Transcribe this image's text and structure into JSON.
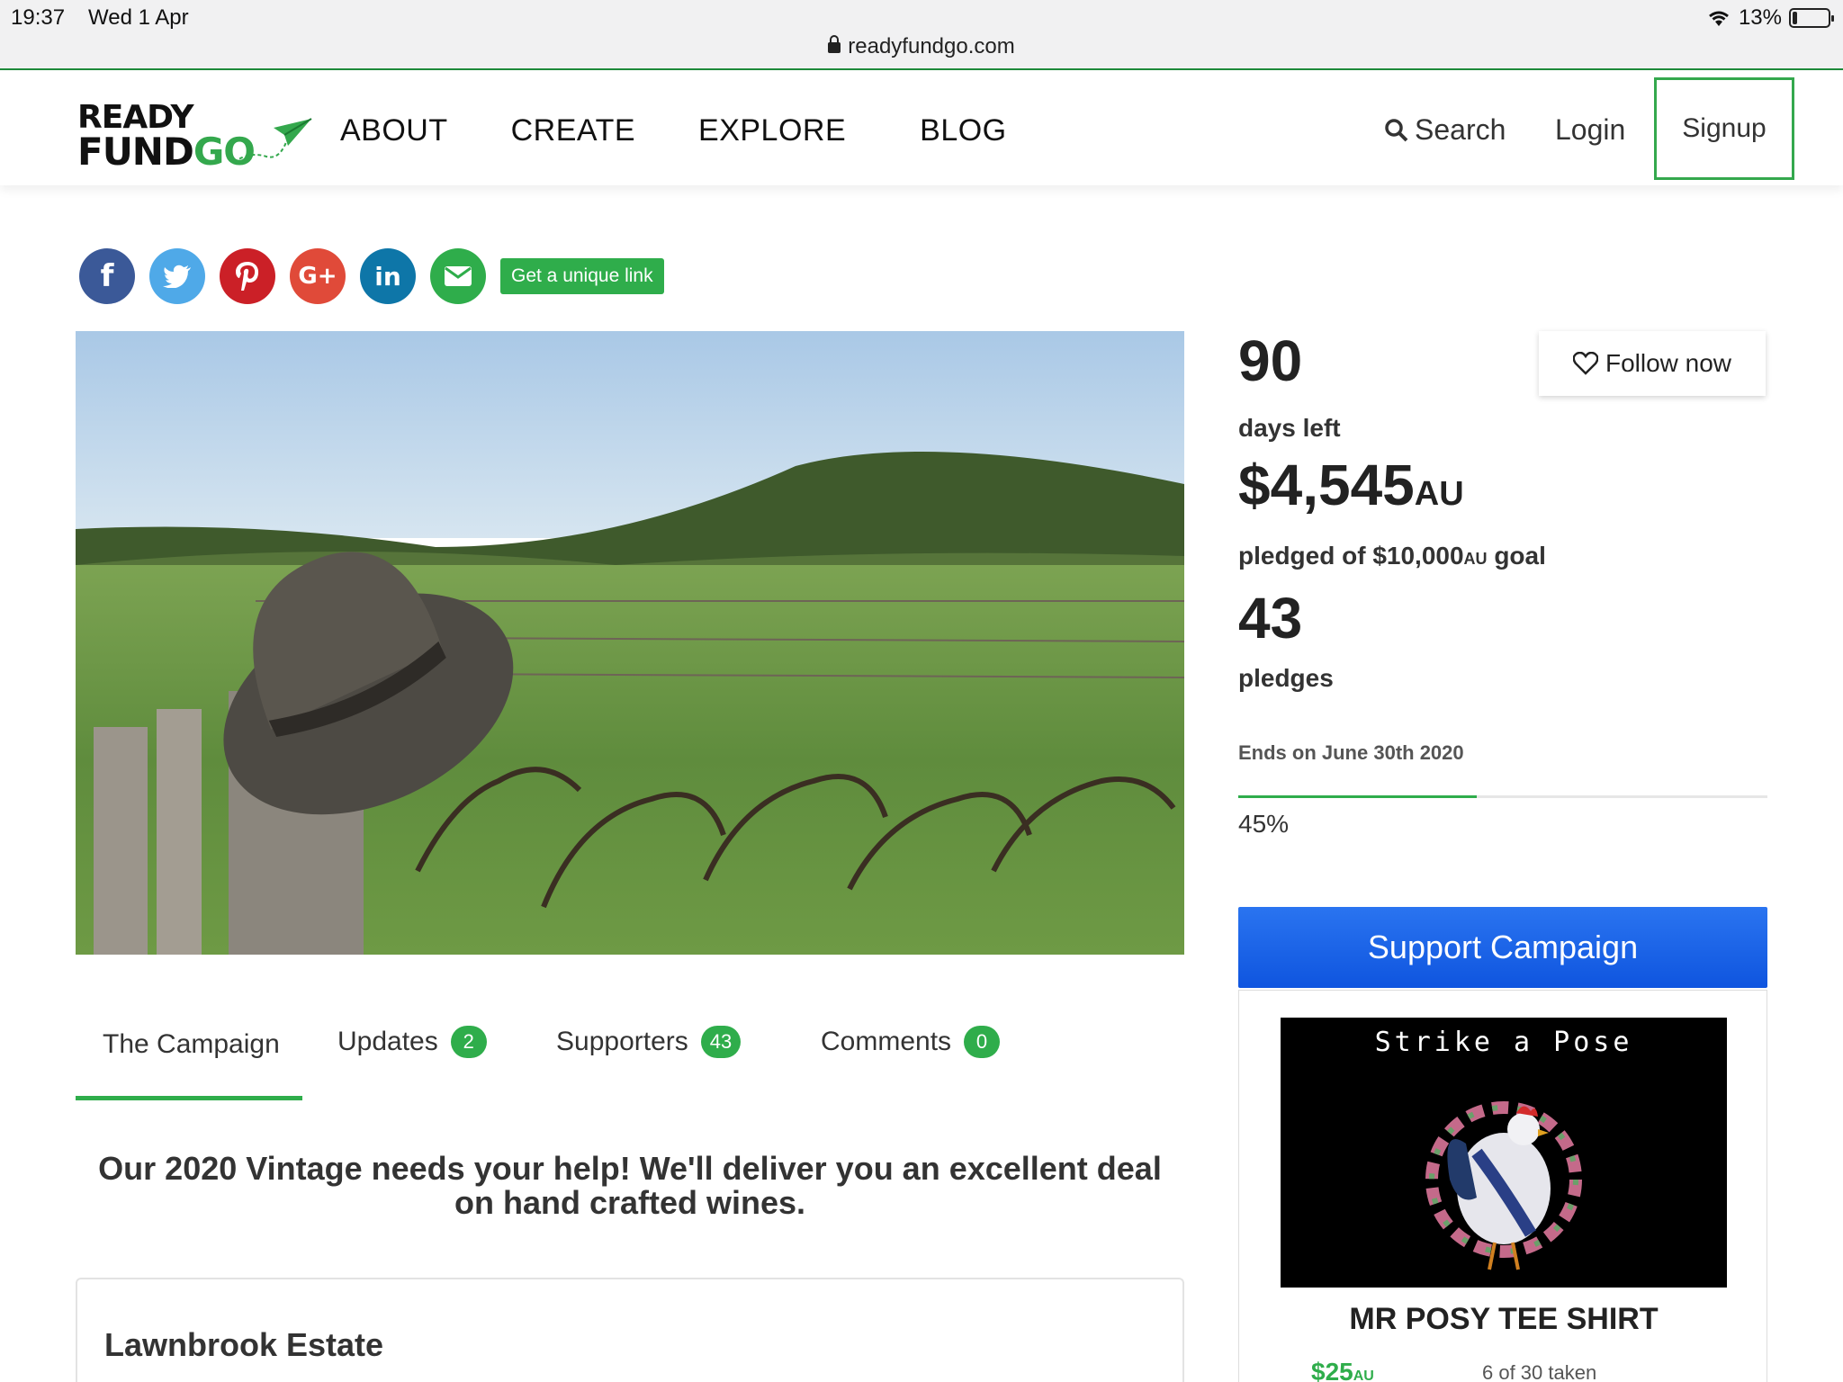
{
  "status_bar": {
    "time": "19:37",
    "date": "Wed 1 Apr",
    "battery": "13%",
    "url": "readyfundgo.com"
  },
  "nav": {
    "logo_line1": "READY",
    "logo_line2a": "FUND",
    "logo_line2b": "GO",
    "links": [
      "ABOUT",
      "CREATE",
      "EXPLORE",
      "BLOG"
    ],
    "search": "Search",
    "login": "Login",
    "signup": "Signup"
  },
  "share": {
    "unique_link": "Get a unique link",
    "icons": [
      "facebook-icon",
      "twitter-icon",
      "pinterest-icon",
      "google-plus-icon",
      "linkedin-icon",
      "email-icon"
    ]
  },
  "stats": {
    "days_left": "90",
    "days_left_label": "days left",
    "pledged": "$4,545",
    "pledged_currency": "AU",
    "pledged_label_prefix": "pledged of $10,000",
    "pledged_label_currency": "AU",
    "pledged_label_suffix": " goal",
    "pledges": "43",
    "pledges_label": "pledges",
    "ends": "Ends on June 30th 2020",
    "progress_percent": 45,
    "progress_label": "45%"
  },
  "follow_button": "Follow now",
  "support_button": "Support Campaign",
  "reward": {
    "image_text": "Strike a Pose",
    "title": "MR POSY TEE SHIRT",
    "price": "$25",
    "price_currency": "AU",
    "taken": "6 of 30 taken"
  },
  "tabs": [
    {
      "label": "The Campaign",
      "badge": ""
    },
    {
      "label": "Updates",
      "badge": "2"
    },
    {
      "label": "Supporters",
      "badge": "43"
    },
    {
      "label": "Comments",
      "badge": "0"
    }
  ],
  "tagline": "Our 2020 Vintage needs your help! We'll deliver you an excellent deal on hand crafted wines.",
  "story_title": "Lawnbrook Estate",
  "colors": {
    "brand_green": "#2fad4b",
    "support_blue": "#1560e6"
  }
}
